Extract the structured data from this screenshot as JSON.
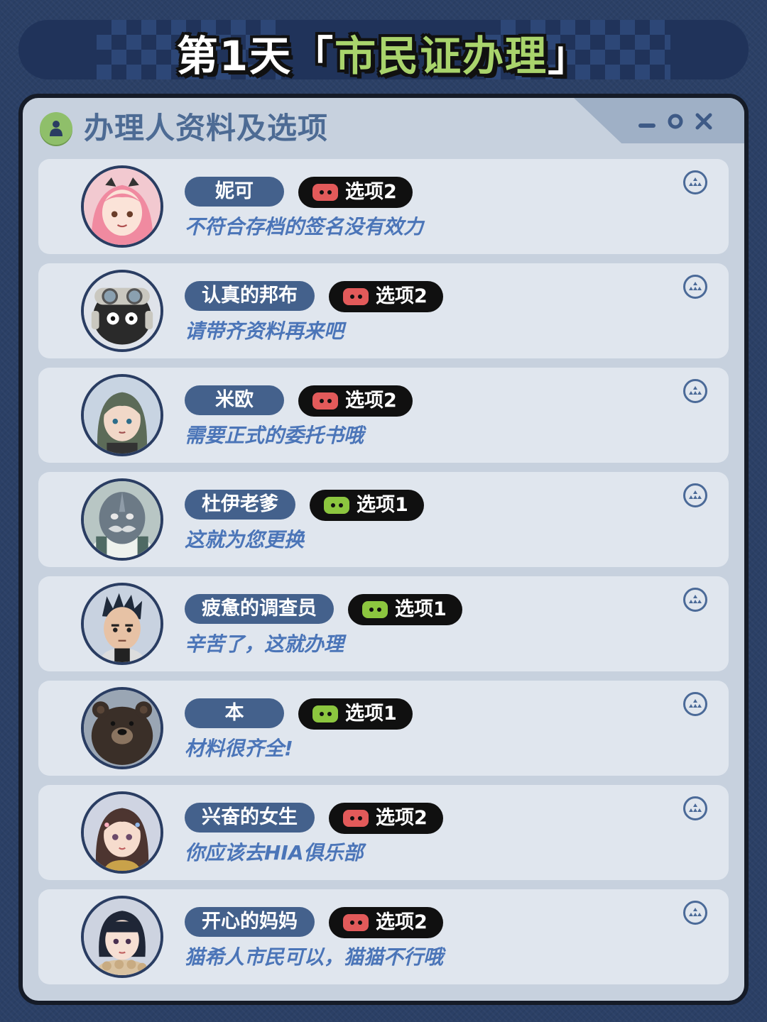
{
  "banner": {
    "day_label": "第1天",
    "bracket_open": "「",
    "task_label": "市民证办理",
    "bracket_close": "」"
  },
  "window": {
    "title": "办理人资料及选项",
    "icons": [
      "person-icon",
      "minimize-icon",
      "maximize-icon",
      "close-icon"
    ]
  },
  "rows": [
    {
      "name": "妮可",
      "option": "选项2",
      "option_color": "red",
      "answer": "不符合存档的签名没有效力"
    },
    {
      "name": "认真的邦布",
      "option": "选项2",
      "option_color": "red",
      "answer": "请带齐资料再来吧"
    },
    {
      "name": "米欧",
      "option": "选项2",
      "option_color": "red",
      "answer": "需要正式的委托书哦"
    },
    {
      "name": "杜伊老爹",
      "option": "选项1",
      "option_color": "green",
      "answer": "这就为您更换"
    },
    {
      "name": "疲惫的调查员",
      "option": "选项1",
      "option_color": "green",
      "answer": "辛苦了，这就办理"
    },
    {
      "name": "本",
      "option": "选项1",
      "option_color": "green",
      "answer": "材料很齐全!"
    },
    {
      "name": "兴奋的女生",
      "option": "选项2",
      "option_color": "red",
      "answer": "你应该去HIA俱乐部"
    },
    {
      "name": "开心的妈妈",
      "option": "选项2",
      "option_color": "red",
      "answer": "猫希人市民可以，猫猫不行哦"
    }
  ],
  "colors": {
    "background": "#2b4066",
    "panel": "#c7d1de",
    "row": "#e0e6ee",
    "name_pill": "#44618c",
    "answer_text": "#4b75b8",
    "option_red": "#e25a5a",
    "option_green": "#8cc63f",
    "title_green": "#a9d46c"
  }
}
